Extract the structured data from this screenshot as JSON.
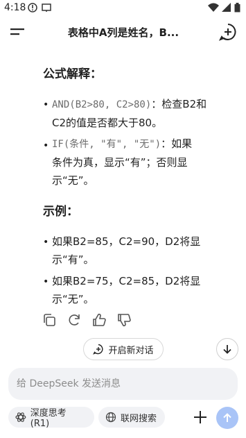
{
  "status": {
    "time": "4:18"
  },
  "header": {
    "title": "表格中A列是姓名，B..."
  },
  "sections": {
    "formula_heading": "公式解释：",
    "formula_item1_code": "AND(B2>80, C2>80)",
    "formula_item1_text_line1": "：检查B2和",
    "formula_item1_text_line2": "C2的值是否都大于80。",
    "formula_item2_code": "IF(条件, \"有\", \"无\")",
    "formula_item2_text_line1": "：如果",
    "formula_item2_text_line2": "条件为真，显示“有”；否则显",
    "formula_item2_text_line3": "示“无”。",
    "example_heading": "示例：",
    "example_item1_line1": "如果B2=85，C2=90，D2将显",
    "example_item1_line2": "示“有”。",
    "example_item2_line1": "如果B2=75，C2=85，D2将显",
    "example_item2_line2": "示“无”。"
  },
  "buttons": {
    "new_dialog": "开启新对话"
  },
  "input": {
    "placeholder": "给 DeepSeek 发送消息"
  },
  "chips": {
    "deep_think": "深度思考 (R1)",
    "web_search": "联网搜索"
  },
  "colors": {
    "send": "#a9c4f7",
    "input_bg": "#f1f2f5"
  }
}
